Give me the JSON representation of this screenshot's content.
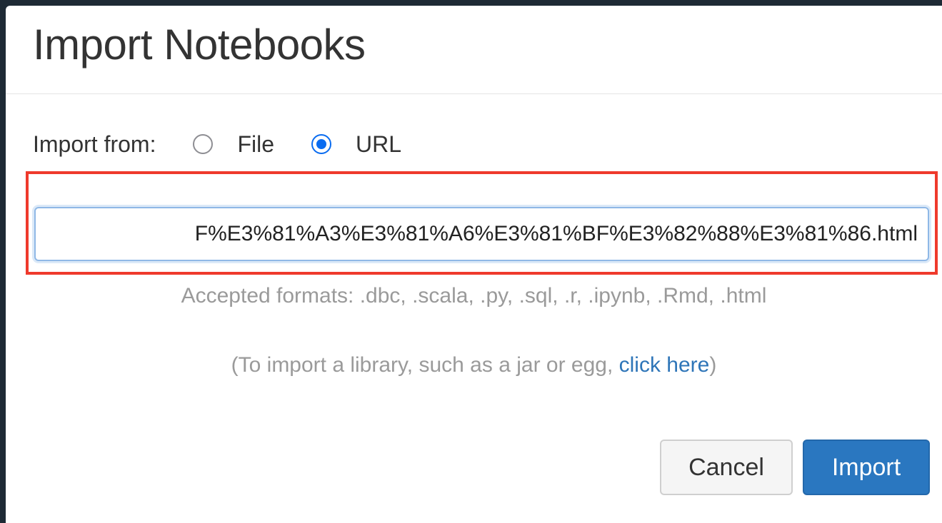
{
  "dialog": {
    "title": "Import Notebooks",
    "import_from_label": "Import from:",
    "options": [
      {
        "label": "File",
        "selected": false
      },
      {
        "label": "URL",
        "selected": true
      }
    ],
    "url_value": "F%E3%81%A3%E3%81%A6%E3%81%BF%E3%82%88%E3%81%86.html",
    "accepted_formats": "Accepted formats: .dbc, .scala, .py, .sql, .r, .ipynb, .Rmd, .html",
    "library_prefix": "(To import a library, such as a jar or egg, ",
    "library_link": "click here",
    "library_suffix": ")",
    "buttons": {
      "cancel": "Cancel",
      "import": "Import"
    }
  },
  "colors": {
    "primary": "#2a77c0",
    "highlight": "#ef3a2c",
    "radio_selected": "#0a6cf0",
    "link": "#2e75b8"
  }
}
